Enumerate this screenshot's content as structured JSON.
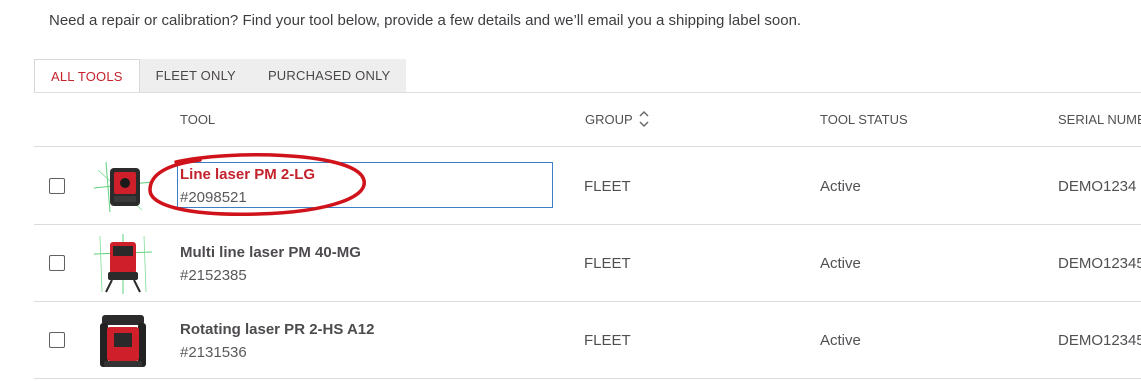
{
  "intro_text": "Need a repair or calibration? Find your tool below, provide a few details and we’ll email you a shipping label soon.",
  "tabs": [
    {
      "label": "ALL TOOLS",
      "active": true
    },
    {
      "label": "FLEET ONLY",
      "active": false
    },
    {
      "label": "PURCHASED ONLY",
      "active": false
    }
  ],
  "columns": {
    "tool": "TOOL",
    "group": "GROUP",
    "status": "TOOL STATUS",
    "serial": "SERIAL NUMBE"
  },
  "rows": [
    {
      "name": "Line laser PM 2-LG",
      "number": "#2098521",
      "group": "FLEET",
      "status": "Active",
      "serial": "DEMO1234",
      "checked": false
    },
    {
      "name": "Multi line laser PM 40-MG",
      "number": "#2152385",
      "group": "FLEET",
      "status": "Active",
      "serial": "DEMO12345",
      "checked": false
    },
    {
      "name": "Rotating laser PR 2-HS A12",
      "number": "#2131536",
      "group": "FLEET",
      "status": "Active",
      "serial": "DEMO12345",
      "checked": false
    }
  ],
  "colors": {
    "accent": "#c4232e",
    "focus_outline": "#3c7fc5",
    "annotation": "#d0121b"
  },
  "icons": [
    "sort-arrows-icon",
    "checkbox-icon"
  ]
}
